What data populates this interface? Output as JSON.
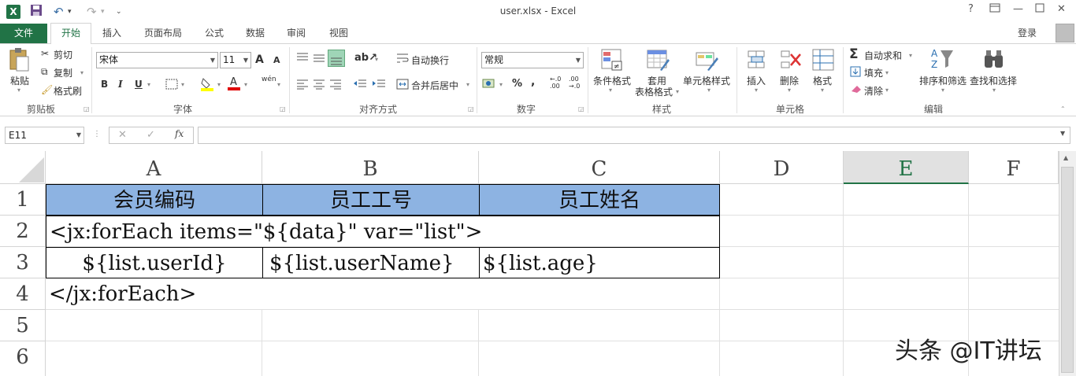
{
  "window": {
    "title": "user.xlsx - Excel",
    "help": "?",
    "login": "登录"
  },
  "tabs": [
    "文件",
    "开始",
    "插入",
    "页面布局",
    "公式",
    "数据",
    "审阅",
    "视图"
  ],
  "ribbon": {
    "clipboard": {
      "group": "剪贴板",
      "paste": "粘贴",
      "cut": "剪切",
      "copy": "复制",
      "painter": "格式刷"
    },
    "font": {
      "group": "字体",
      "name": "宋体",
      "size": "11",
      "bold": "B",
      "italic": "I",
      "underline": "U",
      "grow": "A",
      "shrink": "A",
      "color": "A",
      "phonetic": "wén"
    },
    "alignment": {
      "group": "对齐方式",
      "wrap": "自动换行",
      "merge": "合并后居中"
    },
    "number": {
      "group": "数字",
      "format": "常规",
      "percent": "%",
      "comma": ",",
      "inc": "←.0 .00",
      "dec": ".00 →.0"
    },
    "styles": {
      "group": "样式",
      "conditional": "条件格式",
      "table_line1": "套用",
      "table_line2": "表格格式",
      "cell_styles": "单元格样式"
    },
    "cells": {
      "group": "单元格",
      "insert": "插入",
      "delete": "删除",
      "format": "格式"
    },
    "editing": {
      "group": "编辑",
      "autosum": "自动求和",
      "fill": "填充",
      "clear": "清除",
      "sort": "排序和筛选",
      "find": "查找和选择"
    }
  },
  "formula_bar": {
    "name_box": "E11",
    "fx": "fx",
    "cancel": "✕",
    "enter": "✓",
    "value": ""
  },
  "columns": [
    "A",
    "B",
    "C",
    "D",
    "E",
    "F"
  ],
  "rows": [
    "1",
    "2",
    "3",
    "4",
    "5",
    "6"
  ],
  "cells": {
    "A1": "会员编码",
    "B1": "员工工号",
    "C1": "员工姓名",
    "A2": "<jx:forEach items=\"${data}\" var=\"list\">",
    "A3": "${list.userId}",
    "B3": "${list.userName}",
    "C3": "${list.age}",
    "A4": "</jx:forEach>"
  },
  "colors": {
    "accent": "#217346",
    "header_fill": "#8db3e2"
  },
  "watermark": "头条 @IT讲坛"
}
